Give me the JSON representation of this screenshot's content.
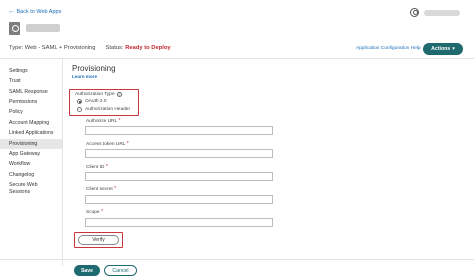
{
  "header": {
    "back_label": "Back to Web Apps",
    "type_text": "Type: Web - SAML + Provisioning",
    "status_label": "Status:",
    "status_value": "Ready to Deploy",
    "config_help": "Application Configuration Help",
    "actions_label": "Actions"
  },
  "icons": {
    "back": "arrow-left-icon",
    "user": "user-circle-icon",
    "actions": "chevron-down-icon",
    "info": "info-icon"
  },
  "colors": {
    "accent": "#1e6a6e",
    "link": "#1d6fb8",
    "status": "#c0262d",
    "highlight": "#c8373a"
  },
  "sidebar": {
    "items": [
      {
        "label": "Settings"
      },
      {
        "label": "Trust"
      },
      {
        "label": "SAML Response"
      },
      {
        "label": "Permissions"
      },
      {
        "label": "Policy"
      },
      {
        "label": "Account Mapping"
      },
      {
        "label": "Linked Applications"
      },
      {
        "label": "Provisioning"
      },
      {
        "label": "App Gateway"
      },
      {
        "label": "Workflow"
      },
      {
        "label": "Changelog"
      },
      {
        "label": "Secure Web"
      },
      {
        "label": "Sessions"
      }
    ],
    "active": "Provisioning"
  },
  "main": {
    "title": "Provisioning",
    "learn_more": "Learn more",
    "auth": {
      "label": "Authorization Type",
      "options": [
        "OAuth 2.0",
        "Authorization Header"
      ],
      "selected": "OAuth 2.0"
    },
    "fields": [
      {
        "label": "Authorize URL",
        "required": true,
        "value": ""
      },
      {
        "label": "Access token URL",
        "required": true,
        "value": ""
      },
      {
        "label": "Client ID",
        "required": true,
        "value": ""
      },
      {
        "label": "Client secret",
        "required": true,
        "value": ""
      },
      {
        "label": "Scope",
        "required": true,
        "value": ""
      }
    ],
    "verify_label": "Verify"
  },
  "footer": {
    "save_label": "Save",
    "cancel_label": "Cancel"
  }
}
